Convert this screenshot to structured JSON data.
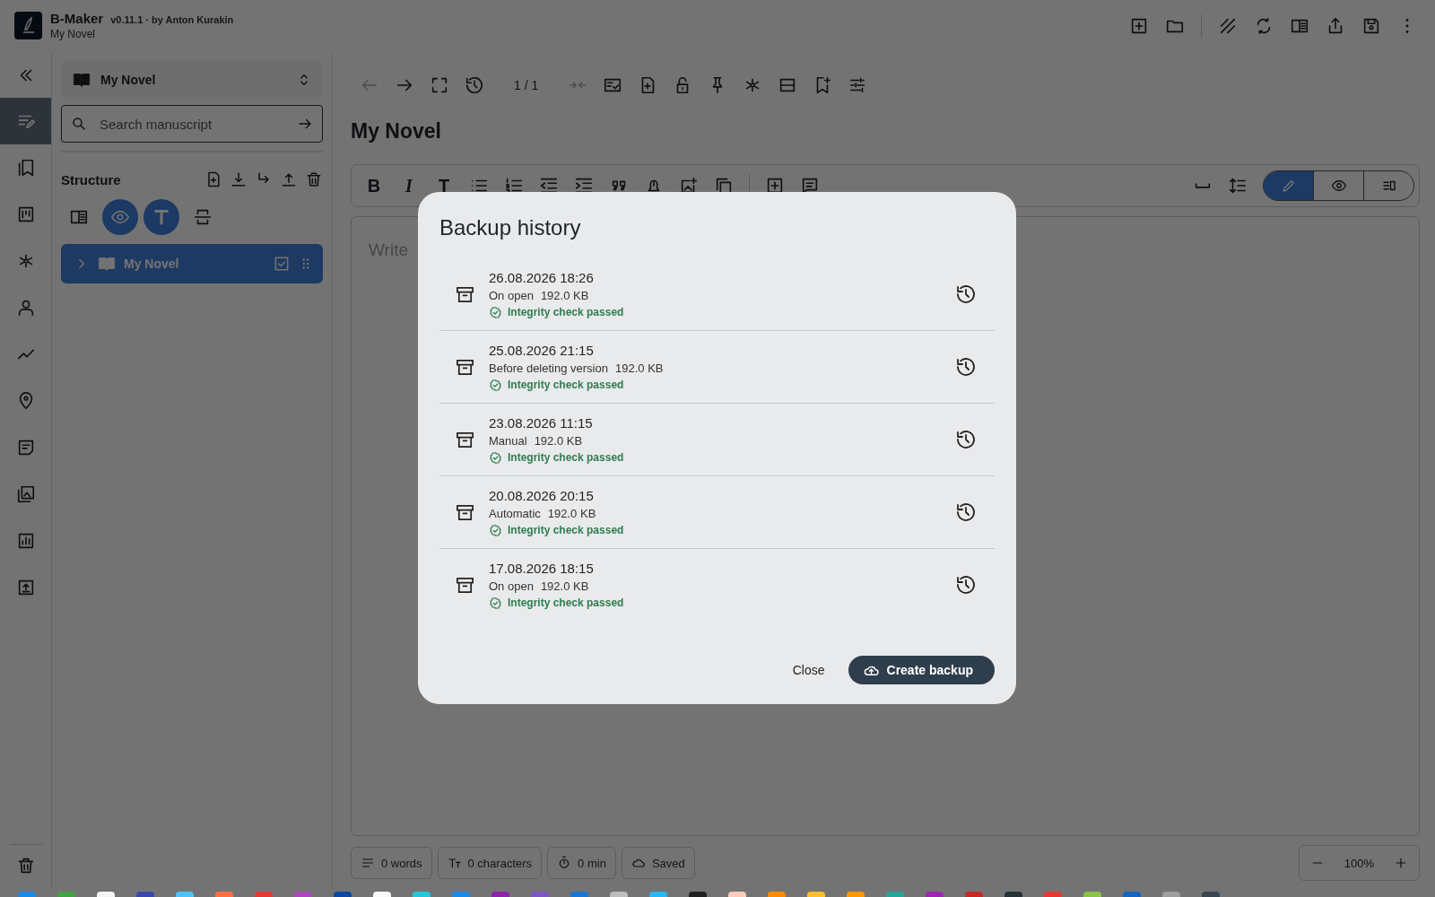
{
  "app": {
    "name": "B-Maker",
    "version": "v0.11.1 · by Anton Kurakin",
    "project": "My Novel"
  },
  "rail": [
    {
      "kind": "editor",
      "selected": true
    },
    {
      "kind": "bookmarks",
      "selected": false
    },
    {
      "kind": "board",
      "selected": false
    },
    {
      "kind": "graph",
      "selected": false
    },
    {
      "kind": "characters",
      "selected": false
    },
    {
      "kind": "plot",
      "selected": false
    },
    {
      "kind": "locations",
      "selected": false
    },
    {
      "kind": "notes",
      "selected": false
    },
    {
      "kind": "gallery",
      "selected": false
    },
    {
      "kind": "stats",
      "selected": false
    },
    {
      "kind": "export",
      "selected": false
    }
  ],
  "sidebar": {
    "project_select": "My Novel",
    "search": {
      "placeholder": "Search manuscript"
    },
    "structure_title": "Structure",
    "view_toggles": [
      {
        "kind": "panel",
        "selected": false
      },
      {
        "kind": "eye",
        "selected": true
      },
      {
        "kind": "text",
        "selected": true
      },
      {
        "kind": "scan",
        "selected": false
      }
    ],
    "tree": [
      {
        "label": "My Novel",
        "selected": true,
        "expanded": false
      }
    ]
  },
  "editor": {
    "page_indicator": "1 / 1",
    "title": "My Novel",
    "format_buttons": [
      "B",
      "I",
      "T"
    ],
    "placeholder": "Write",
    "modes": [
      {
        "kind": "edit",
        "selected": true
      },
      {
        "kind": "preview",
        "selected": false
      },
      {
        "kind": "split",
        "selected": false
      }
    ]
  },
  "status_bar": {
    "words": "0 words",
    "characters": "0 characters",
    "time": "0 min",
    "saved": "Saved",
    "zoom": "100%"
  },
  "dialog": {
    "title": "Backup history",
    "backups": [
      {
        "date": "26.08.2026 18:26",
        "reason": "On open",
        "size": "192.0 KB",
        "integrity": "Integrity check passed"
      },
      {
        "date": "25.08.2026 21:15",
        "reason": "Before deleting version",
        "size": "192.0 KB",
        "integrity": "Integrity check passed"
      },
      {
        "date": "23.08.2026 11:15",
        "reason": "Manual",
        "size": "192.0 KB",
        "integrity": "Integrity check passed"
      },
      {
        "date": "20.08.2026 20:15",
        "reason": "Automatic",
        "size": "192.0 KB",
        "integrity": "Integrity check passed"
      },
      {
        "date": "17.08.2026 18:15",
        "reason": "On open",
        "size": "192.0 KB",
        "integrity": "Integrity check passed"
      }
    ],
    "close": "Close",
    "create": "Create backup"
  },
  "taskbar": [
    {
      "color": "#1e88e5"
    },
    {
      "color": "#43a047"
    },
    {
      "color": "#f5f5f5"
    },
    {
      "color": "#3949ab"
    },
    {
      "color": "#4fc3f7"
    },
    {
      "color": "#ff7043"
    },
    {
      "color": "#e53935"
    },
    {
      "color": "#ab47bc"
    },
    {
      "color": "#0d47a1"
    },
    {
      "color": "#fafafa"
    },
    {
      "color": "#26c6da"
    },
    {
      "color": "#1e88e5"
    },
    {
      "color": "#8e24aa"
    },
    {
      "color": "#7e57c2"
    },
    {
      "color": "#1976d2"
    },
    {
      "color": "#bdbdbd"
    },
    {
      "color": "#29b6f6"
    },
    {
      "color": "#212121"
    },
    {
      "color": "#ffccbc"
    },
    {
      "color": "#fb8c00"
    },
    {
      "color": "#fbc02d"
    },
    {
      "color": "#ff9800"
    },
    {
      "color": "#26a69a"
    },
    {
      "color": "#9c27b0"
    },
    {
      "color": "#c62828"
    },
    {
      "color": "#263238"
    },
    {
      "color": "#e53935"
    },
    {
      "color": "#8bc34a"
    },
    {
      "color": "#1565c0"
    },
    {
      "color": "#9e9e9e"
    },
    {
      "color": "#37474f"
    }
  ]
}
